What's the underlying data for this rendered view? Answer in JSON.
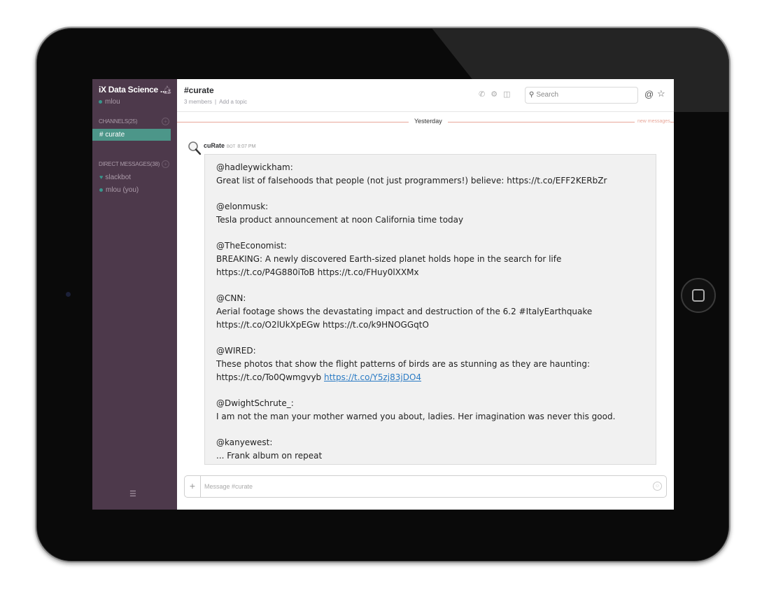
{
  "sidebar": {
    "team_name": "iX Data Science ...",
    "user": "mlou",
    "channels_label": "CHANNELS",
    "channels_count": "(25)",
    "active_channel": "# curate",
    "dm_label": "DIRECT MESSAGES",
    "dm_count": "(38)",
    "dms": [
      "slackbot",
      "mlou (you)"
    ]
  },
  "header": {
    "channel": "#curate",
    "members": "3 members",
    "add_topic": "Add a topic",
    "search_placeholder": "Search"
  },
  "divider": {
    "label": "Yesterday",
    "new_messages": "new messages"
  },
  "message": {
    "sender": "cuRate",
    "bot_tag": "BOT",
    "time": "8:07 PM",
    "tweets": [
      {
        "handle": "@hadleywickham:",
        "lines": [
          "Great list of falsehoods that people (not just programmers!) believe: https://t.co/EFF2KERbZr"
        ]
      },
      {
        "handle": "@elonmusk:",
        "lines": [
          "Tesla product announcement at noon California time today"
        ]
      },
      {
        "handle": "@TheEconomist:",
        "lines": [
          "BREAKING: A newly discovered Earth-sized planet holds hope in the search for life",
          "https://t.co/P4G880iToB https://t.co/FHuy0lXXMx"
        ]
      },
      {
        "handle": "@CNN:",
        "lines": [
          "Aerial footage shows the devastating impact and destruction of the 6.2 #ItalyEarthquake",
          "https://t.co/O2lUkXpEGw https://t.co/k9HNOGGqtO"
        ]
      },
      {
        "handle": "@WIRED:",
        "lines": [
          "These photos that show the flight patterns of birds are as stunning as they are haunting:",
          "https://t.co/To0Qwmgvyb"
        ],
        "link": "https://t.co/Y5zj83jDO4"
      },
      {
        "handle": "@DwightSchrute_:",
        "lines": [
          "I am not the man your mother warned you about, ladies. Her imagination was never this good."
        ]
      },
      {
        "handle": "@kanyewest:",
        "lines": [
          "... Frank album on repeat"
        ]
      }
    ]
  },
  "composer": {
    "placeholder": "Message #curate"
  }
}
